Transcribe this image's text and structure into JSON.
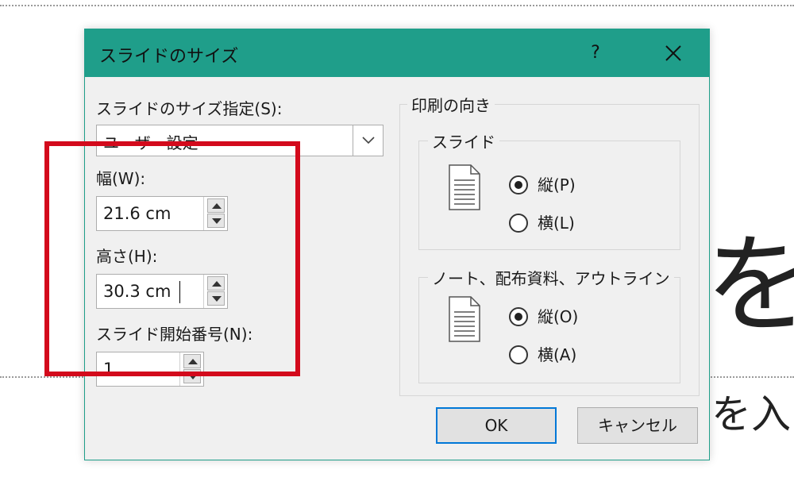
{
  "background": {
    "large_char": "を",
    "small_text": "を入"
  },
  "dialog": {
    "title": "スライドのサイズ",
    "help_label": "?",
    "size_label": "スライドのサイズ指定(S):",
    "size_value": "ユーザー設定",
    "width_label": "幅(W):",
    "width_value": "21.6 cm",
    "height_label": "高さ(H):",
    "height_value": "30.3 cm",
    "start_label": "スライド開始番号(N):",
    "start_value": "1",
    "orientation_label": "印刷の向き",
    "slide_group_label": "スライド",
    "slide_portrait": "縦(P)",
    "slide_landscape": "横(L)",
    "notes_group_label": "ノート、配布資料、アウトライン",
    "notes_portrait": "縦(O)",
    "notes_landscape": "横(A)",
    "ok_label": "OK",
    "cancel_label": "キャンセル"
  },
  "colors": {
    "titlebar": "#1f9e8a",
    "highlight": "#d30a1c",
    "default_button_border": "#0078d7"
  }
}
